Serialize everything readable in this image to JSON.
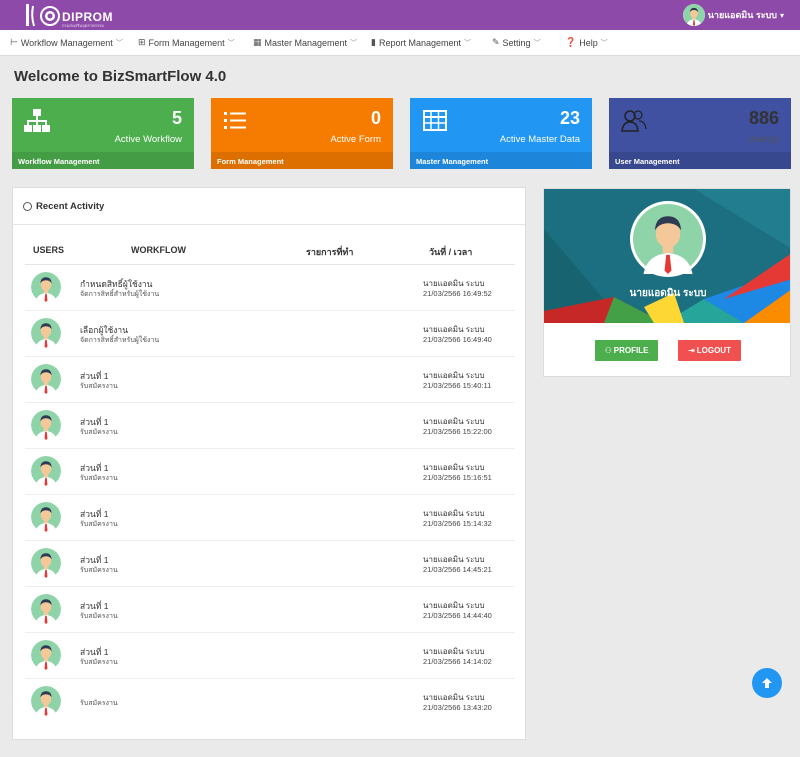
{
  "brand": {
    "name": "DIPROM",
    "tagline": "กรมส่งเสริมอุตสาหกรรม"
  },
  "top_user": {
    "name": "นายแอดมิน ระบบ"
  },
  "nav": [
    {
      "label": "Workflow Management",
      "icon": "tree-icon"
    },
    {
      "label": "Form Management",
      "icon": "grid-icon"
    },
    {
      "label": "Master Management",
      "icon": "table-icon"
    },
    {
      "label": "Report Management",
      "icon": "chart-icon"
    },
    {
      "label": "Setting",
      "icon": "wrench-icon"
    },
    {
      "label": "Help",
      "icon": "question-icon"
    }
  ],
  "page_title": "Welcome to BizSmartFlow 4.0",
  "cards": [
    {
      "value": "5",
      "label": "Active Workflow",
      "footer": "Workflow Management",
      "color": "#4cae4c",
      "icon": "sitemap-icon"
    },
    {
      "value": "0",
      "label": "Active Form",
      "footer": "Form Management",
      "color": "#f57c00",
      "icon": "list-icon"
    },
    {
      "value": "23",
      "label": "Active Master Data",
      "footer": "Master Management",
      "color": "#2196f3",
      "icon": "table-icon"
    },
    {
      "value": "886",
      "label": "User(s)",
      "footer": "User Management",
      "color": "#3f51a0",
      "icon": "users-icon"
    }
  ],
  "activity": {
    "title": "Recent Activity",
    "headers": {
      "users": "USERS",
      "workflow": "WORKFLOW",
      "item": "รายการที่ทำ",
      "date": "วันที่ / เวลา"
    },
    "rows": [
      {
        "title": "กำหนดสิทธิ์ผู้ใช้งาน",
        "sub": "จัดการสิทธิ์สำหรับผู้ใช้งาน",
        "user": "นายแอดมิน ระบบ",
        "datetime": "21/03/2566 16:49:52"
      },
      {
        "title": "เลือกผู้ใช้งาน",
        "sub": "จัดการสิทธิ์สำหรับผู้ใช้งาน",
        "user": "นายแอดมิน ระบบ",
        "datetime": "21/03/2566 16:49:40"
      },
      {
        "title": "ส่วนที่ 1",
        "sub": "รับสมัครงาน",
        "user": "นายแอดมิน ระบบ",
        "datetime": "21/03/2566 15:40:11"
      },
      {
        "title": "ส่วนที่ 1",
        "sub": "รับสมัครงาน",
        "user": "นายแอดมิน ระบบ",
        "datetime": "21/03/2566 15:22:00"
      },
      {
        "title": "ส่วนที่ 1",
        "sub": "รับสมัครงาน",
        "user": "นายแอดมิน ระบบ",
        "datetime": "21/03/2566 15:16:51"
      },
      {
        "title": "ส่วนที่ 1",
        "sub": "รับสมัครงาน",
        "user": "นายแอดมิน ระบบ",
        "datetime": "21/03/2566 15:14:32"
      },
      {
        "title": "ส่วนที่ 1",
        "sub": "รับสมัครงาน",
        "user": "นายแอดมิน ระบบ",
        "datetime": "21/03/2566 14:45:21"
      },
      {
        "title": "ส่วนที่ 1",
        "sub": "รับสมัครงาน",
        "user": "นายแอดมิน ระบบ",
        "datetime": "21/03/2566 14:44:40"
      },
      {
        "title": "ส่วนที่ 1",
        "sub": "รับสมัครงาน",
        "user": "นายแอดมิน ระบบ",
        "datetime": "21/03/2566 14:14:02"
      },
      {
        "title": "",
        "sub": "รับสมัครงาน",
        "user": "นายแอดมิน ระบบ",
        "datetime": "21/03/2566 13:43:20"
      }
    ]
  },
  "profile": {
    "name": "นายแอดมิน ระบบ",
    "profile_label": "PROFILE",
    "logout_label": "LOGOUT"
  }
}
